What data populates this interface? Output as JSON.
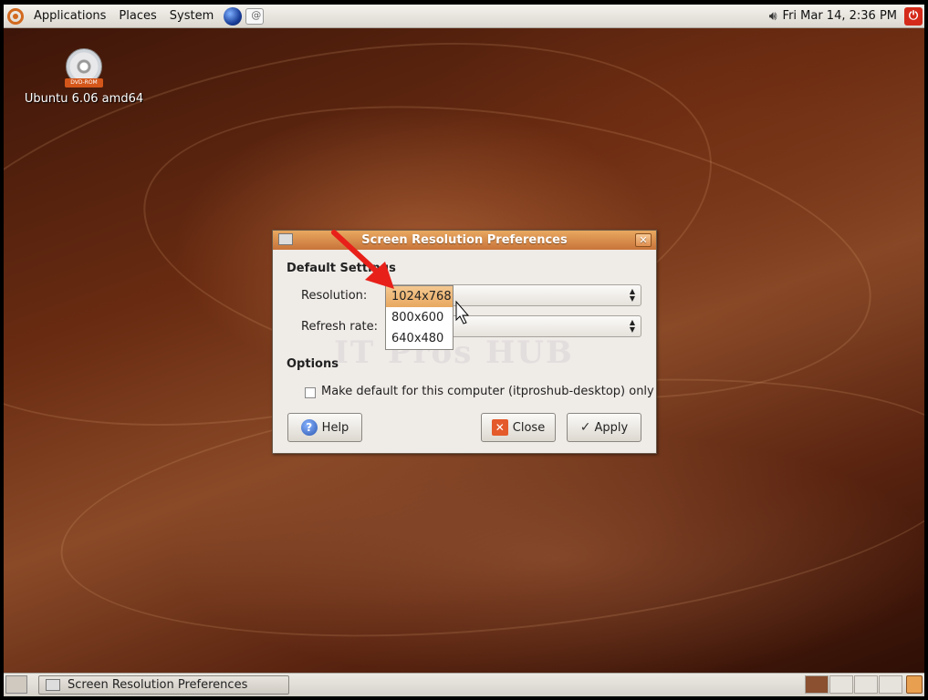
{
  "top_panel": {
    "menus": [
      "Applications",
      "Places",
      "System"
    ],
    "clock": "Fri Mar 14,  2:36 PM"
  },
  "desktop": {
    "icon_label": "Ubuntu 6.06 amd64",
    "icon_badge": "DVD-ROM"
  },
  "dialog": {
    "title": "Screen Resolution Preferences",
    "section_default": "Default Settings",
    "resolution_label": "Resolution:",
    "refresh_label": "Refresh rate:",
    "resolution_options": [
      "1024x768",
      "800x600",
      "640x480"
    ],
    "selected_resolution": "1024x768",
    "section_options": "Options",
    "checkbox_label": "Make default for this computer (itproshub-desktop) only",
    "checkbox_checked": false,
    "help_label": "Help",
    "close_label": "Close",
    "apply_label": "Apply"
  },
  "watermark": "IT Pros HUB",
  "taskbar": {
    "window_title": "Screen Resolution Preferences"
  },
  "colors": {
    "titlebar": "#d0843e",
    "annotation_arrow": "#e8201a",
    "selected_option": "#f0b878"
  }
}
